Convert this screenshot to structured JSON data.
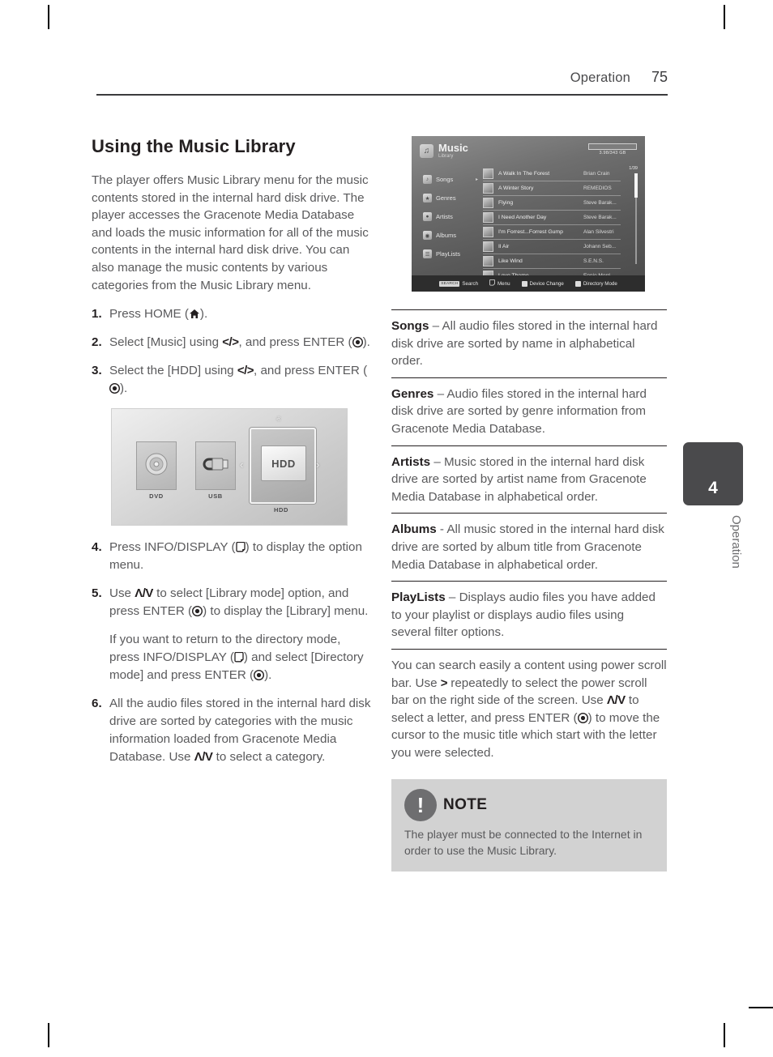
{
  "header": {
    "section": "Operation",
    "page_number": "75"
  },
  "left": {
    "title": "Using the Music Library",
    "intro": "The player offers Music Library menu for the music contents stored in the internal hard disk drive. The player accesses the Gracenote Media Database and loads the music information for all of the music contents in the internal hard disk drive. You can also manage the music contents by various categories from the Music Library menu.",
    "steps": [
      {
        "num": "1.",
        "text_a": "Press HOME (",
        "text_b": ").",
        "icons": [
          "home-icon"
        ]
      },
      {
        "num": "2.",
        "text_a": "Select [Music] using ",
        "arrows": "</>",
        "text_b": ", and press ENTER (",
        "text_c": ").",
        "icons": [
          "enter-icon"
        ]
      },
      {
        "num": "3.",
        "text_a": "Select the [HDD] using ",
        "arrows": "</>",
        "text_b": ", and press ENTER (",
        "text_c": ").",
        "icons": [
          "enter-icon"
        ]
      },
      {
        "num": "4.",
        "text_a": "Press INFO/DISPLAY (",
        "text_b": ") to display the option menu.",
        "icons": [
          "info-display-icon"
        ]
      },
      {
        "num": "5.",
        "text_a": "Use ",
        "arrows": "Λ/V",
        "text_b": " to select [Library mode] option, and press ENTER (",
        "text_c": ") to display the [Library] menu.",
        "icons": [
          "enter-icon"
        ]
      },
      {
        "num": "6.",
        "text_a": "All the audio files stored in the internal hard disk drive are sorted by categories with the music information loaded from Gracenote Media Database. Use ",
        "arrows": "Λ/V",
        "text_b": " to select a category."
      }
    ],
    "substep_5": {
      "text_a": "If you want to return to the directory mode, press INFO/DISPLAY (",
      "text_b": ") and select [Directory mode] and press ENTER (",
      "text_c": ")."
    },
    "device_screenshot": {
      "items": [
        {
          "label": "DVD",
          "icon": "disc-icon",
          "selected": false
        },
        {
          "label": "USB",
          "icon": "usb-icon",
          "selected": false
        },
        {
          "label": "HDD",
          "icon": "hdd-icon",
          "selected": true
        }
      ],
      "selected_label": "HDD",
      "nav_left": "‹",
      "nav_right": "›",
      "nav_up": "ⱏ",
      "nav_down": "ⱟ"
    }
  },
  "right": {
    "music_screenshot": {
      "title": "Music",
      "subtitle": "Library",
      "capacity": "3.98/343 GB",
      "scroll_position": "1/39",
      "categories": [
        {
          "label": "Songs",
          "icon": "note-icon",
          "selected": true
        },
        {
          "label": "Genres",
          "icon": "genre-icon",
          "selected": false
        },
        {
          "label": "Artists",
          "icon": "artist-icon",
          "selected": false
        },
        {
          "label": "Albums",
          "icon": "album-icon",
          "selected": false
        },
        {
          "label": "PlayLists",
          "icon": "playlist-icon",
          "selected": false
        }
      ],
      "tracks": [
        {
          "title": "A Walk In The Forest",
          "artist": "Brian Crain"
        },
        {
          "title": "A Winter Story",
          "artist": "REMEDIOS"
        },
        {
          "title": "Flying",
          "artist": "Steve Barak..."
        },
        {
          "title": "I Need Another Day",
          "artist": "Steve Barak..."
        },
        {
          "title": "I'm Forrest...Forrest Gump",
          "artist": "Alan Silvestri"
        },
        {
          "title": "Il Air",
          "artist": "Johann Seb..."
        },
        {
          "title": "Like Wind",
          "artist": "S.E.N.S."
        },
        {
          "title": "Love Theme",
          "artist": "Ennio Morri..."
        }
      ],
      "footer": [
        {
          "key": "SEARCH",
          "label": "Search",
          "key_type": "text"
        },
        {
          "key": "",
          "label": "Menu",
          "key_type": "page"
        },
        {
          "key": "B",
          "label": "Device Change",
          "key_type": "square"
        },
        {
          "key": "Y",
          "label": "Directory Mode",
          "key_type": "square"
        }
      ]
    },
    "definitions": [
      {
        "term": "Songs",
        "dash": " – ",
        "desc": "All audio files stored in the internal hard disk drive are sorted by name in alphabetical order."
      },
      {
        "term": "Genres",
        "dash": " – ",
        "desc": "Audio files stored in the internal hard disk drive are sorted by genre information from Gracenote Media Database."
      },
      {
        "term": "Artists",
        "dash": " – ",
        "desc": "Music stored in the internal hard disk drive are sorted by artist name from Gracenote Media Database in alphabetical order."
      },
      {
        "term": "Albums",
        "dash": " - ",
        "desc": "All music stored in the internal hard disk drive are sorted by album title from Gracenote Media Database in alphabetical order."
      },
      {
        "term": "PlayLists",
        "dash": " – ",
        "desc": "Displays audio files you have added to your playlist or displays audio files using several filter options."
      }
    ],
    "power_scroll": {
      "part_a": "You can search easily a content using power scroll bar. Use ",
      "arrow_1": ">",
      "part_b": " repeatedly to select the power scroll bar on the right side of the screen. Use ",
      "arrow_2": "Λ/V",
      "part_c": " to select a letter, and press ENTER (",
      "part_d": ") to move the cursor to the music title which start with the letter you were selected."
    },
    "note": {
      "icon": "exclamation-icon",
      "glyph": "!",
      "title": "NOTE",
      "body": "The player must be connected to the Internet in order to use the Music Library."
    }
  },
  "side_tab": {
    "number": "4",
    "label": "Operation"
  }
}
